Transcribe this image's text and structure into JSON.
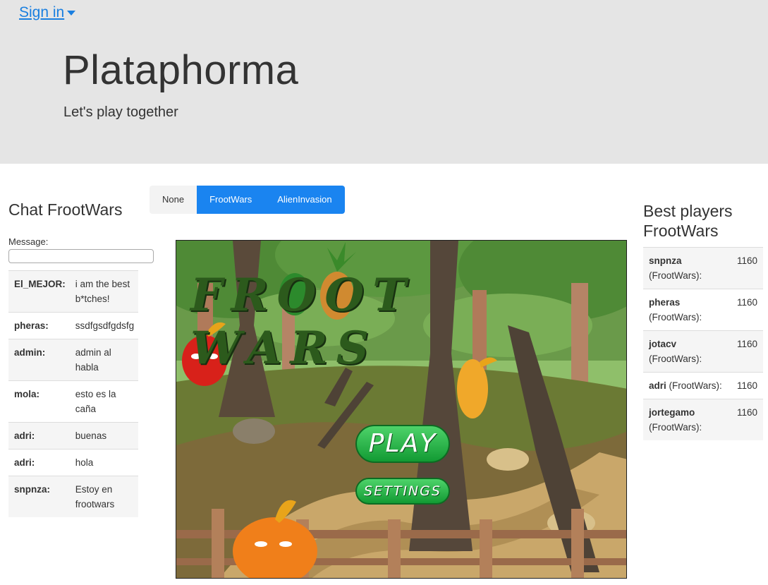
{
  "header": {
    "signin_label": "Sign in",
    "title": "Plataphorma",
    "tagline": "Let's play together"
  },
  "chat": {
    "title": "Chat FrootWars",
    "message_label": "Message:",
    "message_value": "",
    "messages": [
      {
        "user": "El_MEJOR:",
        "text": "i am the best b*tches!"
      },
      {
        "user": "pheras:",
        "text": "ssdfgsdfgdsfg"
      },
      {
        "user": "admin:",
        "text": "admin al habla"
      },
      {
        "user": "mola:",
        "text": "esto es la caña"
      },
      {
        "user": "adri:",
        "text": "buenas"
      },
      {
        "user": "adri:",
        "text": "hola"
      },
      {
        "user": "snpnza:",
        "text": "Estoy en frootwars"
      }
    ]
  },
  "games": {
    "tabs": [
      {
        "label": "None",
        "active": false
      },
      {
        "label": "FrootWars",
        "active": true
      },
      {
        "label": "AlienInvasion",
        "active": false
      }
    ],
    "game_title_art": "FROOT WARS",
    "play_label": "PLAY",
    "settings_label": "SETTINGS"
  },
  "ranking": {
    "title": "Best players FrootWars",
    "players": [
      {
        "name": "snpnza",
        "game": "(FrootWars):",
        "score": "1160"
      },
      {
        "name": "pheras",
        "game": "(FrootWars):",
        "score": "1160"
      },
      {
        "name": "jotacv",
        "game": "(FrootWars):",
        "score": "1160"
      },
      {
        "name": "adri",
        "game": "(FrootWars):",
        "score": "1160"
      },
      {
        "name": "jortegamo",
        "game": "(FrootWars):",
        "score": "1160"
      }
    ]
  },
  "colors": {
    "accent": "#1a84f0",
    "link": "#1a7fe0",
    "jumbotron_bg": "#e5e5e5"
  }
}
